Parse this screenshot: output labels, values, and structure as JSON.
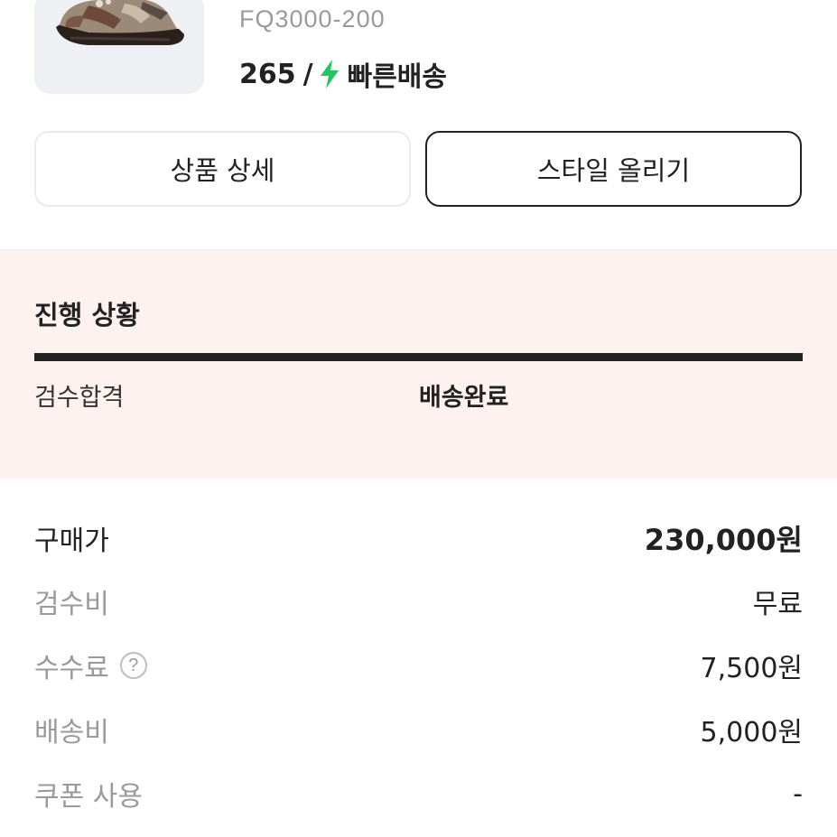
{
  "product": {
    "model_number": "FQ3000-200",
    "size": "265",
    "separator": "/",
    "delivery_label": "빠른배송",
    "colors": {
      "delivery_bolt": "#22c55e"
    }
  },
  "buttons": {
    "detail_label": "상품 상세",
    "style_label": "스타일 올리기"
  },
  "progress": {
    "title": "진행 상황",
    "steps": [
      {
        "label": "검수합격"
      },
      {
        "label": "배송완료"
      }
    ],
    "colors": {
      "background": "#fdf2f0",
      "bar": "#222222"
    }
  },
  "price_rows": [
    {
      "label": "구매가",
      "value": "230,000원"
    },
    {
      "label": "검수비",
      "value": "무료"
    },
    {
      "label": "수수료",
      "value": "7,500원",
      "help_icon": "?"
    },
    {
      "label": "배송비",
      "value": "5,000원"
    },
    {
      "label": "쿠폰 사용",
      "value": "-"
    }
  ]
}
